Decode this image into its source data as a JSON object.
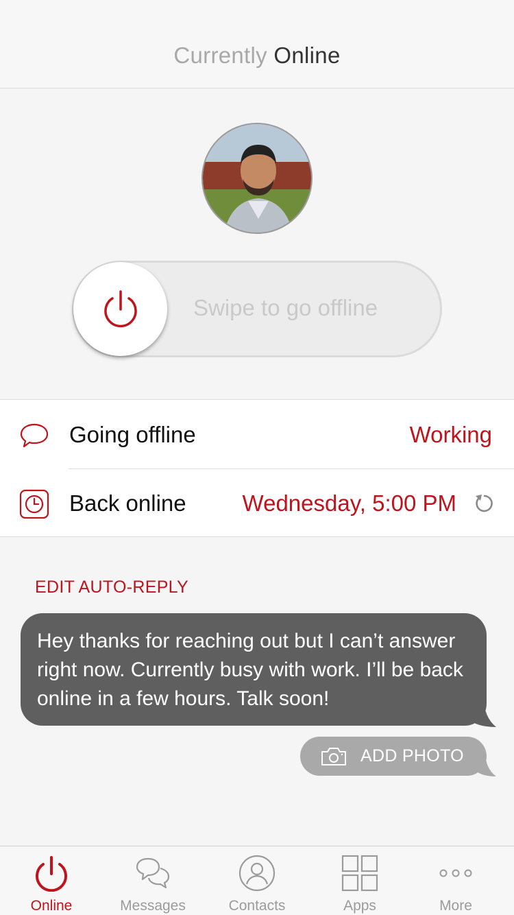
{
  "header": {
    "title_prefix": "Currently",
    "title_status": "Online"
  },
  "profile": {
    "avatar_label": ""
  },
  "swipe": {
    "label": "Swipe to go offline",
    "knob_icon": "power-icon"
  },
  "settings": {
    "going_offline": {
      "label": "Going offline",
      "value": "Working",
      "icon": "speech-bubble-icon"
    },
    "back_online": {
      "label": "Back online",
      "value": "Wednesday, 5:00 PM",
      "icon": "clock-icon",
      "action_icon": "reset-icon"
    }
  },
  "auto_reply": {
    "edit_label": "EDIT AUTO-REPLY",
    "message": "Hey thanks for reaching out but I can’t answer right now. Currently busy with work. I’ll be back online in a few hours. Talk soon!",
    "add_photo_label": "ADD PHOTO"
  },
  "tabs": [
    {
      "label": "Online",
      "icon": "power-icon",
      "active": true
    },
    {
      "label": "Messages",
      "icon": "chat-bubbles-icon",
      "active": false
    },
    {
      "label": "Contacts",
      "icon": "contact-icon",
      "active": false
    },
    {
      "label": "Apps",
      "icon": "grid-icon",
      "active": false
    },
    {
      "label": "More",
      "icon": "more-dots-icon",
      "active": false
    }
  ],
  "colors": {
    "accent": "#c0131b",
    "bubble": "#5f5f5f",
    "muted": "#9b9b9b"
  }
}
